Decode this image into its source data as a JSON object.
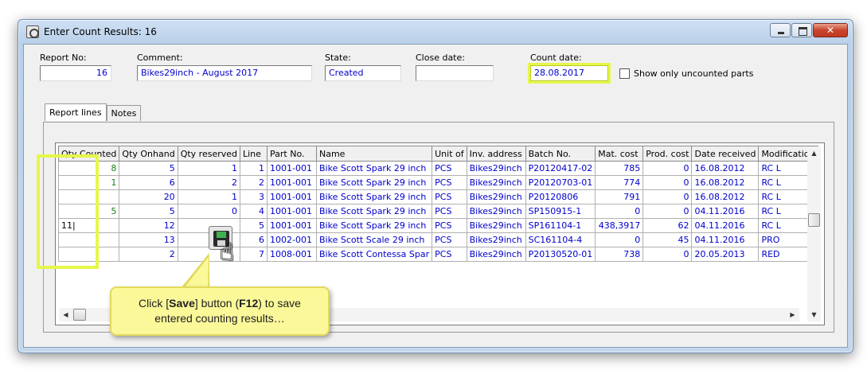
{
  "window": {
    "title": "Enter Count Results: 16"
  },
  "header": {
    "report_no_label": "Report No:",
    "report_no_value": "16",
    "comment_label": "Comment:",
    "comment_value": "Bikes29inch - August 2017",
    "state_label": "State:",
    "state_value": "Created",
    "close_date_label": "Close date:",
    "close_date_value": "",
    "count_date_label": "Count date:",
    "count_date_value": "28.08.2017",
    "show_uncounted_label": "Show only uncounted parts",
    "show_uncounted_checked": false
  },
  "tabs": [
    {
      "label": "Report lines",
      "active": true
    },
    {
      "label": "Notes",
      "active": false
    }
  ],
  "grid": {
    "columns": [
      "Qty Counted",
      "Qty Onhand",
      "Qty reserved",
      "Line",
      "Part No.",
      "Name",
      "Unit of",
      "Inv. address",
      "Batch No.",
      "Mat. cost",
      "Prod. cost",
      "Date received",
      "Modification"
    ],
    "rows": [
      {
        "qty_counted": "8",
        "qty_onhand": "5",
        "qty_reserved": "1",
        "line": "1",
        "part_no": "1001-001",
        "name": "Bike Scott Spark 29 inch",
        "unit": "PCS",
        "inv_address": "Bikes29inch",
        "batch_no": "P20120417-02",
        "mat_cost": "785",
        "prod_cost": "0",
        "date_received": "16.08.2012",
        "modification": "RC L"
      },
      {
        "qty_counted": "1",
        "qty_onhand": "6",
        "qty_reserved": "2",
        "line": "2",
        "part_no": "1001-001",
        "name": "Bike Scott Spark 29 inch",
        "unit": "PCS",
        "inv_address": "Bikes29inch",
        "batch_no": "P20120703-01",
        "mat_cost": "774",
        "prod_cost": "0",
        "date_received": "16.08.2012",
        "modification": "RC L"
      },
      {
        "qty_counted": "",
        "qty_onhand": "20",
        "qty_reserved": "1",
        "line": "3",
        "part_no": "1001-001",
        "name": "Bike Scott Spark 29 inch",
        "unit": "PCS",
        "inv_address": "Bikes29inch",
        "batch_no": "P20120806",
        "mat_cost": "791",
        "prod_cost": "0",
        "date_received": "16.08.2012",
        "modification": "RC L"
      },
      {
        "qty_counted": "5",
        "qty_onhand": "5",
        "qty_reserved": "0",
        "line": "4",
        "part_no": "1001-001",
        "name": "Bike Scott Spark 29 inch",
        "unit": "PCS",
        "inv_address": "Bikes29inch",
        "batch_no": "SP150915-1",
        "mat_cost": "0",
        "prod_cost": "0",
        "date_received": "04.11.2016",
        "modification": "RC L"
      },
      {
        "qty_counted": "11|",
        "qty_onhand": "12",
        "qty_reserved": "",
        "line": "5",
        "part_no": "1001-001",
        "name": "Bike Scott Spark 29 inch",
        "unit": "PCS",
        "inv_address": "Bikes29inch",
        "batch_no": "SP161104-1",
        "mat_cost": "438,3917",
        "prod_cost": "62",
        "date_received": "04.11.2016",
        "modification": "RC L"
      },
      {
        "qty_counted": "",
        "qty_onhand": "13",
        "qty_reserved": "",
        "line": "6",
        "part_no": "1002-001",
        "name": "Bike Scott Scale 29 inch",
        "unit": "PCS",
        "inv_address": "Bikes29inch",
        "batch_no": "SC161104-4",
        "mat_cost": "0",
        "prod_cost": "45",
        "date_received": "04.11.2016",
        "modification": "PRO"
      },
      {
        "qty_counted": "",
        "qty_onhand": "2",
        "qty_reserved": "",
        "line": "7",
        "part_no": "1008-001",
        "name": "Bike Scott Contessa Spar",
        "unit": "PCS",
        "inv_address": "Bikes29inch",
        "batch_no": "P20130520-01",
        "mat_cost": "738",
        "prod_cost": "0",
        "date_received": "20.05.2013",
        "modification": "RED"
      }
    ]
  },
  "icons": {
    "save": "save-icon",
    "cursor": "hand-pointer-icon"
  },
  "callout": {
    "line1_pre": "Click [",
    "line1_bold1": "Save",
    "line1_mid": "] button (",
    "line1_bold2": "F12",
    "line1_post": ") to save",
    "line2": "entered counting results…"
  },
  "colors": {
    "value_text": "#0000cc",
    "qty_counted_text": "#1a7f1a",
    "highlight": "#e5f74a",
    "callout_bg": "#fbf89a"
  }
}
